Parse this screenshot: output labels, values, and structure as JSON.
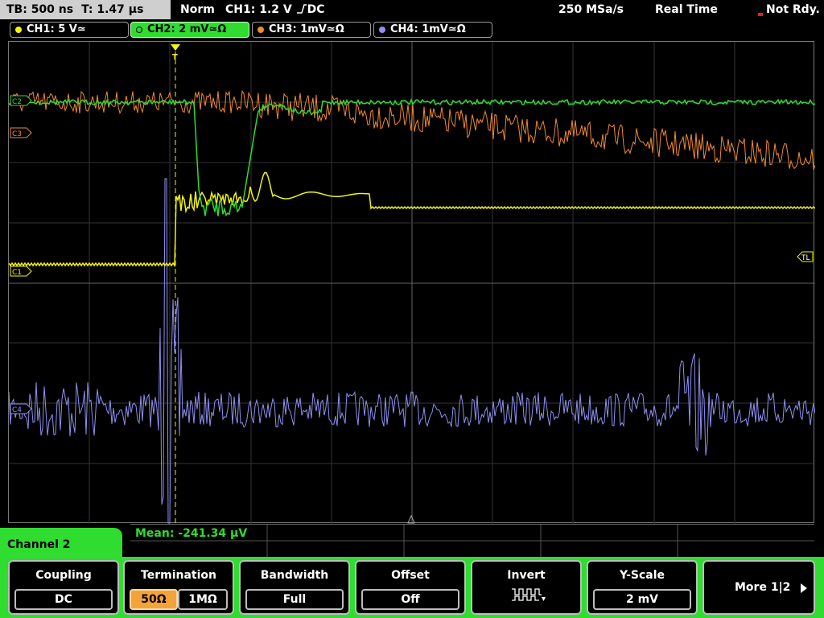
{
  "topbar": {
    "timebase": "TB: 500 ns",
    "trigger_time": "T: 1.47 µs",
    "mode": "Norm",
    "trigger_info": "CH1: 1.2 V",
    "trigger_coupling": "DC",
    "sample_rate": "250 MSa/s",
    "acq_mode": "Real Time",
    "status": "Not Rdy."
  },
  "channels": [
    {
      "label": "CH1: 5 V≃",
      "color": "#f4f40c"
    },
    {
      "label": "CH2: 2 mV≃Ω",
      "color": "#2fdc2f"
    },
    {
      "label": "CH3: 1mV≃Ω",
      "color": "#f28a2e"
    },
    {
      "label": "CH4: 1mV≃Ω",
      "color": "#8f8ff2"
    }
  ],
  "markers": {
    "c1": "C1",
    "c2": "C2",
    "c3": "C3",
    "c4": "C4",
    "tl": "TL",
    "trigger": "T"
  },
  "measurement": {
    "text": "Mean: -241.34 µV"
  },
  "menu": {
    "channel_label": "Channel 2",
    "coupling": {
      "title": "Coupling",
      "value": "DC"
    },
    "termination": {
      "title": "Termination",
      "value_a": "50Ω",
      "value_b": "1MΩ"
    },
    "bandwidth": {
      "title": "Bandwidth",
      "value": "Full"
    },
    "offset": {
      "title": "Offset",
      "value": "Off"
    },
    "invert": {
      "title": "Invert"
    },
    "yscale": {
      "title": "Y-Scale",
      "value": "2 mV"
    },
    "more": {
      "title": "More 1|2"
    }
  }
}
